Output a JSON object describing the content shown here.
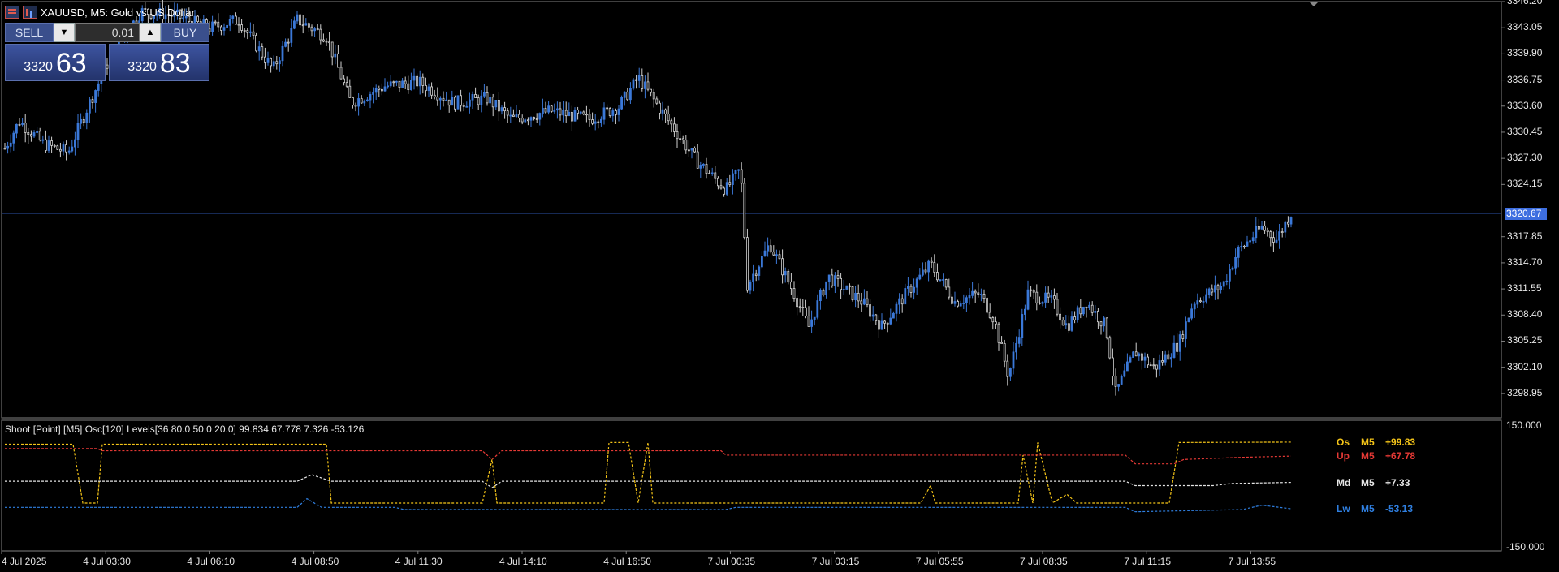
{
  "window": {
    "symbol_title": "XAUUSD, M5:  Gold vs US Dollar"
  },
  "trade_panel": {
    "sell_label": "SELL",
    "buy_label": "BUY",
    "lot_value": "0.01",
    "sell_price_prefix": "3320",
    "sell_price_big": "63",
    "buy_price_prefix": "3320",
    "buy_price_big": "83"
  },
  "price_axis": {
    "labels": [
      "3346.20",
      "3343.05",
      "3339.90",
      "3336.75",
      "3333.60",
      "3330.45",
      "3327.30",
      "3324.15",
      "3317.85",
      "3314.70",
      "3311.55",
      "3308.40",
      "3305.25",
      "3302.10",
      "3298.95"
    ],
    "current_price": "3320.67"
  },
  "indicator": {
    "label": "Shoot [Point] [M5]  Osc[120]  Levels[36 80.0 50.0 20.0] 99.834 67.778 7.326 -53.126",
    "axis_top": "150.000",
    "axis_bottom": "-150.000",
    "legend": [
      {
        "name": "Os",
        "tf": "M5",
        "value": "+99.83",
        "color": "#f5c518"
      },
      {
        "name": "Up",
        "tf": "M5",
        "value": "+67.78",
        "color": "#e53935"
      },
      {
        "name": "Md",
        "tf": "M5",
        "value": "+7.33",
        "color": "#e6e6e6"
      },
      {
        "name": "Lw",
        "tf": "M5",
        "value": "-53.13",
        "color": "#2f7fe0"
      }
    ]
  },
  "time_axis": [
    "4 Jul 2025",
    "4 Jul 03:30",
    "4 Jul 06:10",
    "4 Jul 08:50",
    "4 Jul 11:30",
    "4 Jul 14:10",
    "4 Jul 16:50",
    "7 Jul 00:35",
    "7 Jul 03:15",
    "7 Jul 05:55",
    "7 Jul 08:35",
    "7 Jul 11:15",
    "7 Jul 13:55"
  ],
  "colors": {
    "up_candle": "#3b78d8",
    "down_candle": "#d0d0d0",
    "bid_line": "#3d6ee0",
    "grid_border": "#808080"
  },
  "chart_data": {
    "type": "candlestick",
    "symbol": "XAUUSD",
    "timeframe": "M5",
    "ylim": [
      3296.0,
      3346.2
    ],
    "path_close": [
      {
        "t": 0,
        "p": 3328.5
      },
      {
        "t": 15,
        "p": 3331.8
      },
      {
        "t": 40,
        "p": 3329.0
      },
      {
        "t": 65,
        "p": 3328.0
      },
      {
        "t": 85,
        "p": 3333.5
      },
      {
        "t": 110,
        "p": 3340.0
      },
      {
        "t": 140,
        "p": 3345.0
      },
      {
        "t": 175,
        "p": 3344.5
      },
      {
        "t": 210,
        "p": 3343.0
      },
      {
        "t": 240,
        "p": 3344.0
      },
      {
        "t": 275,
        "p": 3338.0
      },
      {
        "t": 300,
        "p": 3344.0
      },
      {
        "t": 330,
        "p": 3342.0
      },
      {
        "t": 355,
        "p": 3334.0
      },
      {
        "t": 390,
        "p": 3336.0
      },
      {
        "t": 425,
        "p": 3336.5
      },
      {
        "t": 460,
        "p": 3334.0
      },
      {
        "t": 495,
        "p": 3334.5
      },
      {
        "t": 520,
        "p": 3332.0
      },
      {
        "t": 560,
        "p": 3333.0
      },
      {
        "t": 600,
        "p": 3332.0
      },
      {
        "t": 630,
        "p": 3333.5
      },
      {
        "t": 650,
        "p": 3337.0
      },
      {
        "t": 680,
        "p": 3332.0
      },
      {
        "t": 710,
        "p": 3327.0
      },
      {
        "t": 740,
        "p": 3323.5
      },
      {
        "t": 755,
        "p": 3326.0
      },
      {
        "t": 762,
        "p": 3312.0
      },
      {
        "t": 785,
        "p": 3317.0
      },
      {
        "t": 810,
        "p": 3311.0
      },
      {
        "t": 825,
        "p": 3307.0
      },
      {
        "t": 845,
        "p": 3313.0
      },
      {
        "t": 880,
        "p": 3310.0
      },
      {
        "t": 900,
        "p": 3307.0
      },
      {
        "t": 925,
        "p": 3311.0
      },
      {
        "t": 950,
        "p": 3314.5
      },
      {
        "t": 975,
        "p": 3310.0
      },
      {
        "t": 1000,
        "p": 3311.0
      },
      {
        "t": 1015,
        "p": 3308.0
      },
      {
        "t": 1030,
        "p": 3301.0
      },
      {
        "t": 1050,
        "p": 3311.0
      },
      {
        "t": 1075,
        "p": 3310.0
      },
      {
        "t": 1090,
        "p": 3307.0
      },
      {
        "t": 1110,
        "p": 3310.0
      },
      {
        "t": 1130,
        "p": 3307.0
      },
      {
        "t": 1140,
        "p": 3299.0
      },
      {
        "t": 1160,
        "p": 3304.0
      },
      {
        "t": 1180,
        "p": 3302.0
      },
      {
        "t": 1205,
        "p": 3305.0
      },
      {
        "t": 1220,
        "p": 3310.0
      },
      {
        "t": 1250,
        "p": 3312.0
      },
      {
        "t": 1265,
        "p": 3316.0
      },
      {
        "t": 1290,
        "p": 3319.0
      },
      {
        "t": 1305,
        "p": 3317.5
      },
      {
        "t": 1320,
        "p": 3320.67
      }
    ],
    "indicator_series": [
      {
        "name": "Os",
        "levels": [
          [
            0,
            95
          ],
          [
            70,
            95
          ],
          [
            80,
            -40
          ],
          [
            95,
            -40
          ],
          [
            100,
            95
          ],
          [
            255,
            95
          ],
          [
            330,
            95
          ],
          [
            335,
            -40
          ],
          [
            490,
            -40
          ],
          [
            500,
            60
          ],
          [
            505,
            -40
          ],
          [
            615,
            -40
          ],
          [
            620,
            99
          ],
          [
            640,
            99
          ],
          [
            650,
            -40
          ],
          [
            660,
            99
          ],
          [
            665,
            -40
          ],
          [
            940,
            -40
          ],
          [
            950,
            0
          ],
          [
            955,
            -40
          ],
          [
            1040,
            -40
          ],
          [
            1045,
            70
          ],
          [
            1055,
            -40
          ],
          [
            1060,
            99
          ],
          [
            1075,
            -40
          ],
          [
            1090,
            -20
          ],
          [
            1100,
            -40
          ],
          [
            1195,
            -40
          ],
          [
            1205,
            99
          ],
          [
            1320,
            99.83
          ]
        ]
      },
      {
        "name": "Up",
        "levels": [
          [
            0,
            85
          ],
          [
            95,
            85
          ],
          [
            100,
            80
          ],
          [
            490,
            80
          ],
          [
            500,
            60
          ],
          [
            510,
            80
          ],
          [
            735,
            80
          ],
          [
            740,
            70
          ],
          [
            1150,
            70
          ],
          [
            1160,
            50
          ],
          [
            1200,
            50
          ],
          [
            1210,
            60
          ],
          [
            1270,
            65
          ],
          [
            1320,
            67.78
          ]
        ]
      },
      {
        "name": "Md",
        "levels": [
          [
            0,
            10
          ],
          [
            300,
            10
          ],
          [
            315,
            25
          ],
          [
            335,
            10
          ],
          [
            490,
            10
          ],
          [
            500,
            -5
          ],
          [
            510,
            10
          ],
          [
            1150,
            10
          ],
          [
            1160,
            0
          ],
          [
            1240,
            0
          ],
          [
            1260,
            5
          ],
          [
            1320,
            7.33
          ]
        ]
      },
      {
        "name": "Lw",
        "levels": [
          [
            0,
            -50
          ],
          [
            300,
            -50
          ],
          [
            310,
            -30
          ],
          [
            325,
            -50
          ],
          [
            400,
            -50
          ],
          [
            410,
            -55
          ],
          [
            740,
            -55
          ],
          [
            750,
            -50
          ],
          [
            1150,
            -50
          ],
          [
            1160,
            -60
          ],
          [
            1270,
            -55
          ],
          [
            1290,
            -45
          ],
          [
            1320,
            -53.13
          ]
        ]
      }
    ]
  }
}
